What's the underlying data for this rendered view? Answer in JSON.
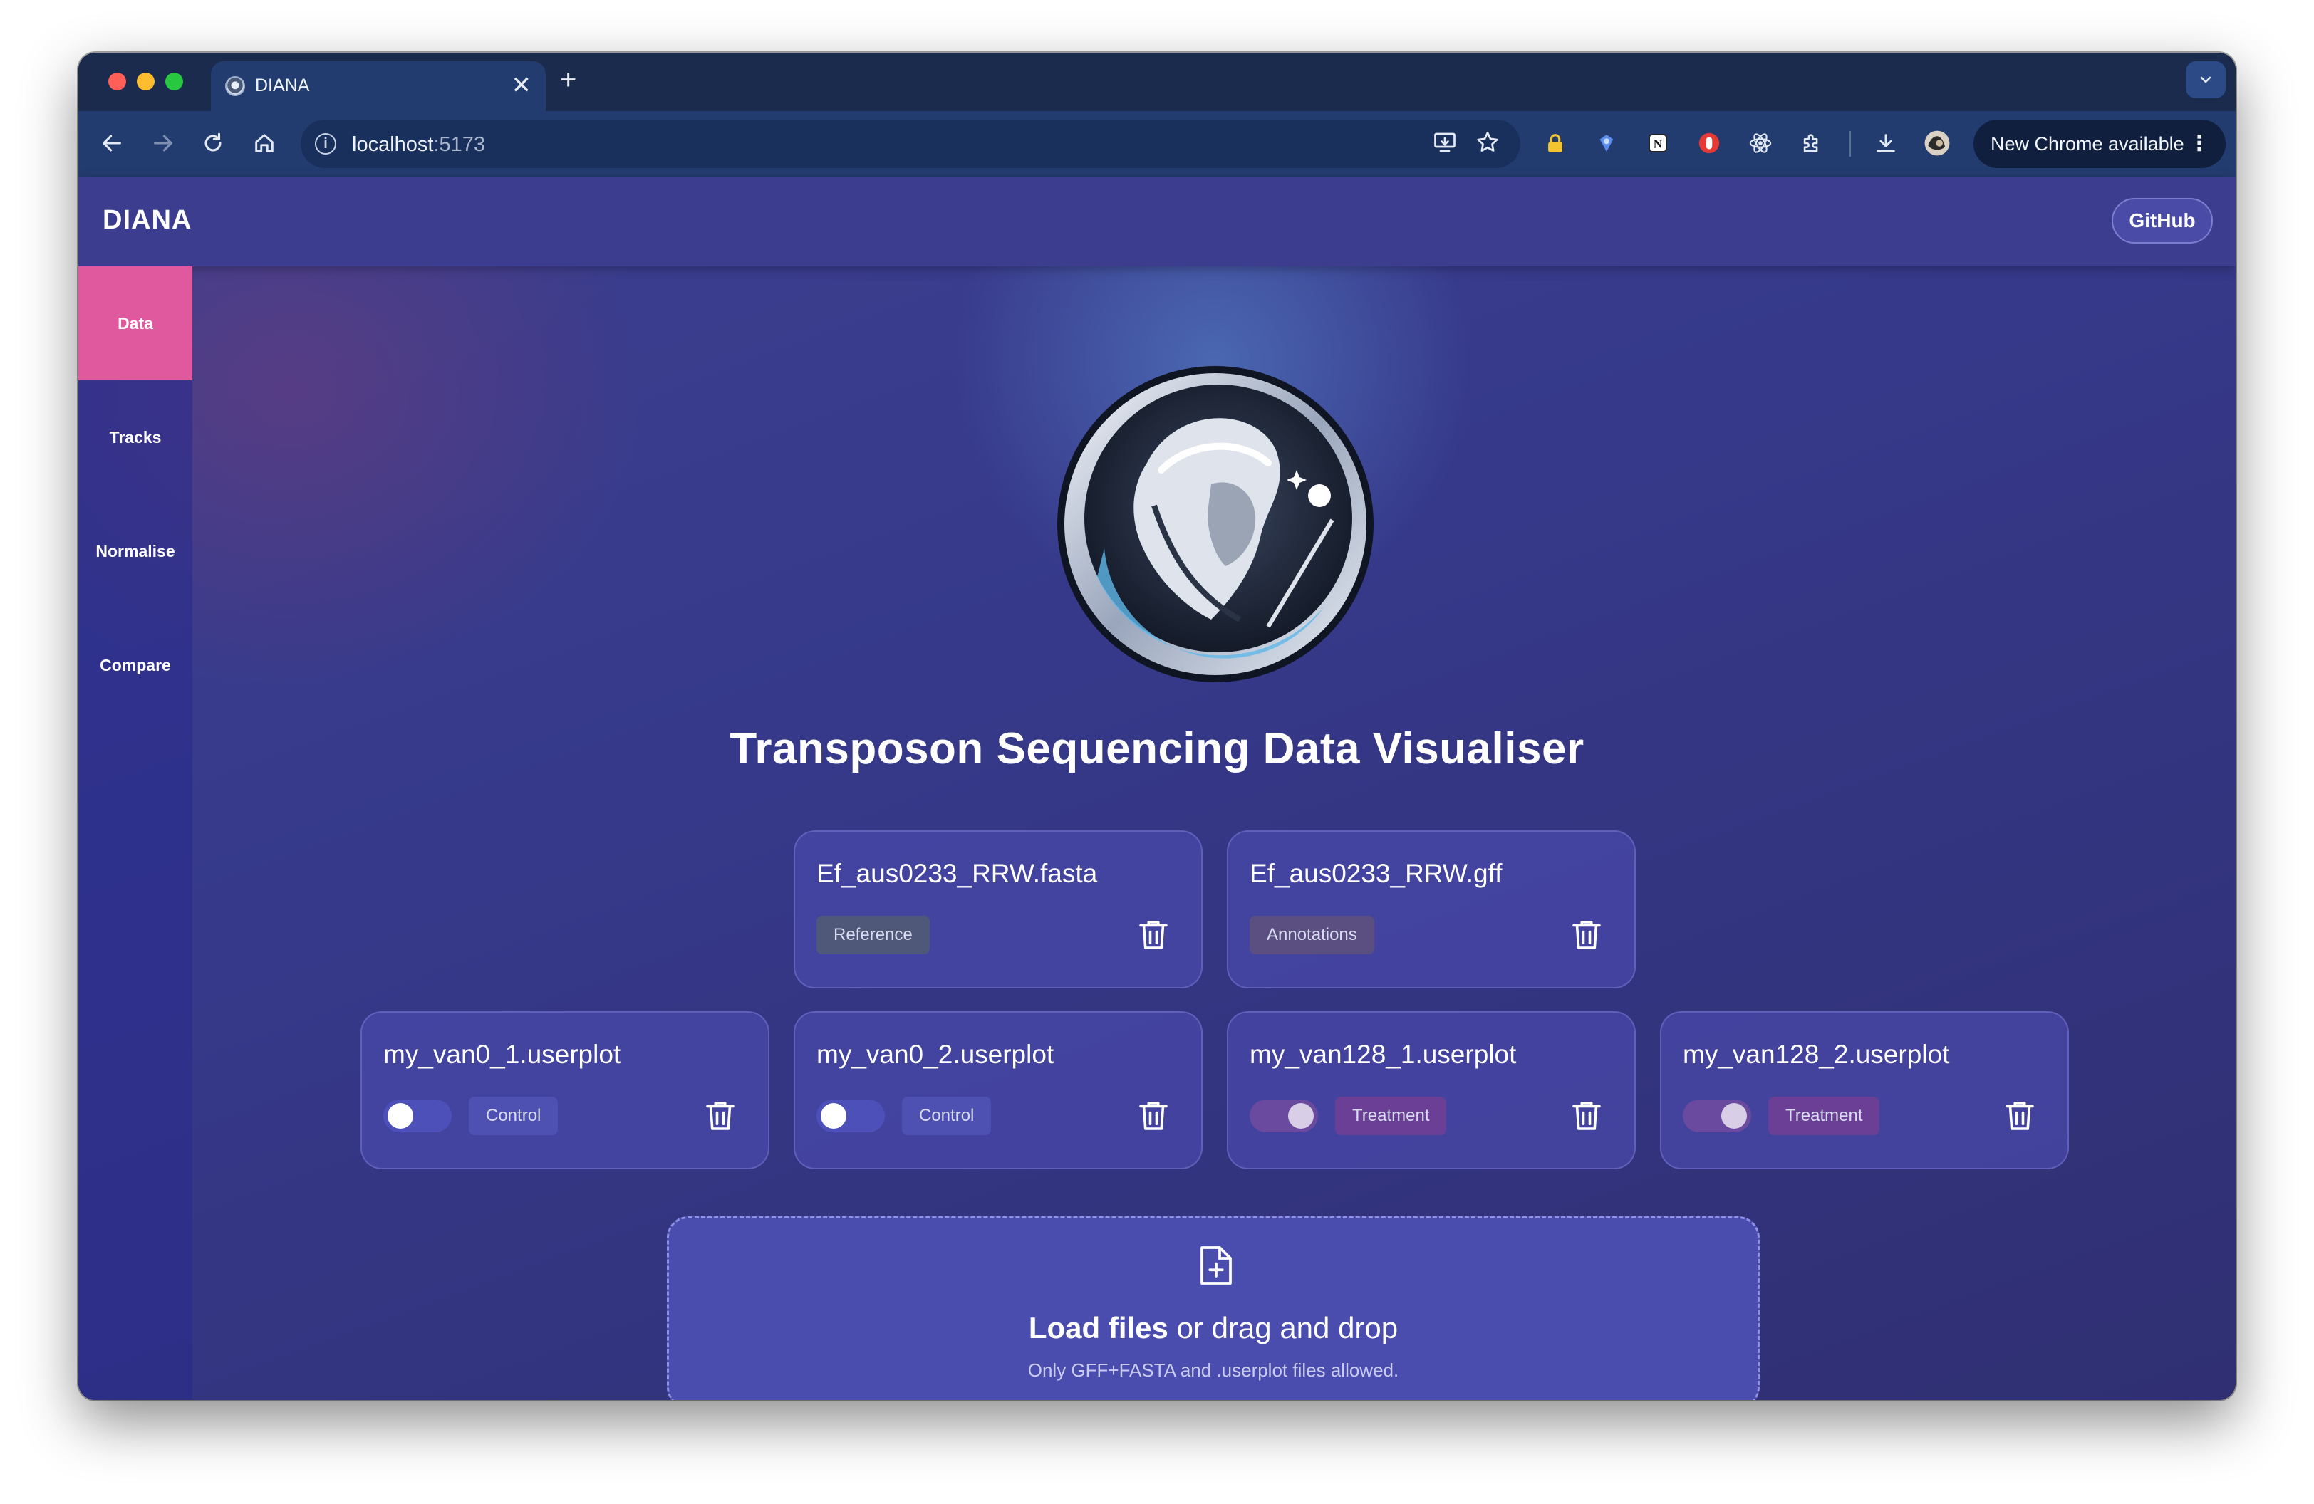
{
  "browser": {
    "tab_title": "DIANA",
    "tab_close": "✕",
    "new_tab": "+",
    "url_host": "localhost",
    "url_port": ":5173",
    "update_button": "New Chrome available",
    "update_menu": "⋮"
  },
  "app": {
    "brand": "DIANA",
    "github_label": "GitHub",
    "title": "Transposon Sequencing Data Visualiser",
    "sidebar": [
      {
        "label": "Data",
        "active": true
      },
      {
        "label": "Tracks",
        "active": false
      },
      {
        "label": "Normalise",
        "active": false
      },
      {
        "label": "Compare",
        "active": false
      }
    ],
    "reference_files": [
      {
        "name": "Ef_aus0233_RRW.fasta",
        "badge": "Reference"
      },
      {
        "name": "Ef_aus0233_RRW.gff",
        "badge": "Annotations"
      }
    ],
    "userplots": [
      {
        "name": "my_van0_1.userplot",
        "group": "Control",
        "toggled": false
      },
      {
        "name": "my_van0_2.userplot",
        "group": "Control",
        "toggled": false
      },
      {
        "name": "my_van128_1.userplot",
        "group": "Treatment",
        "toggled": true
      },
      {
        "name": "my_van128_2.userplot",
        "group": "Treatment",
        "toggled": true
      }
    ],
    "dropzone": {
      "action": "Load files",
      "rest": " or drag and drop",
      "hint": "Only GFF+FASTA and .userplot files allowed."
    }
  },
  "colors": {
    "accent_active": "#e0599e",
    "background": "#36398a",
    "card": "#4848a8",
    "control_badge": "#4e50b2",
    "treatment_badge": "#6b3f95"
  },
  "icons": [
    "back-icon",
    "forward-icon",
    "reload-icon",
    "home-icon",
    "info-icon",
    "install-icon",
    "star-icon",
    "lock-extension-icon",
    "extension-icon",
    "notion-icon",
    "hand-extension-icon",
    "react-icon",
    "puzzle-icon",
    "download-icon",
    "profile-icon",
    "trash-icon",
    "file-plus-icon"
  ]
}
